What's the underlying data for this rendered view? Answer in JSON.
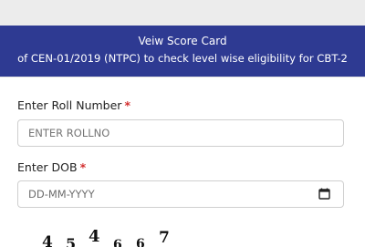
{
  "banner": {
    "title": "Veiw Score Card",
    "subtitle": "of CEN-01/2019 (NTPC) to check level wise eligibility for CBT-2"
  },
  "form": {
    "roll": {
      "label": "Enter Roll Number",
      "required_mark": "*",
      "placeholder": "ENTER ROLLNO"
    },
    "dob": {
      "label": "Enter DOB",
      "required_mark": "*",
      "placeholder": "DD-MM-YYYY",
      "icon": "calendar-icon"
    },
    "captcha": {
      "chars": [
        "4",
        "5",
        "4",
        "6",
        "6",
        "7"
      ]
    }
  },
  "colors": {
    "banner_bg": "#2e3a92",
    "required": "#d32f2f",
    "topbar": "#ececec"
  }
}
